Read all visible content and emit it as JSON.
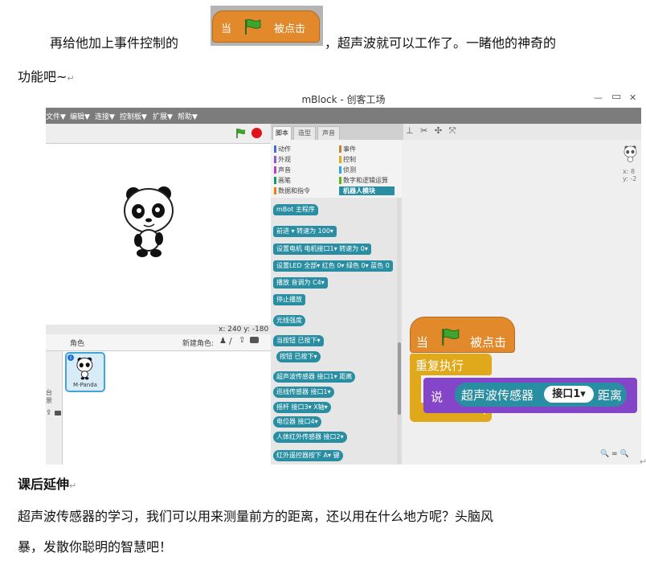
{
  "doc": {
    "line1_before": "再给他加上事件控制的",
    "line1_after": "，超声波就可以工作了。一睹他的神奇的",
    "line2": "功能吧~",
    "para_mark": "↵",
    "heading": "课后延伸",
    "body1": "超声波传感器的学习，我们可以用来测量前方的距离，还以用在什么地方呢？头脑风",
    "body2": "暴，发散你聪明的智慧吧！"
  },
  "inline_block": {
    "left_text": "当",
    "right_text": "被点击"
  },
  "app": {
    "title": "mBlock - 创客工场",
    "window_controls": [
      "—",
      "▭",
      "✕"
    ],
    "menu": [
      "文件▼",
      "编辑▼",
      "连接▼",
      "控制板▼",
      "扩展▼",
      "帮助▼"
    ],
    "tabs": [
      "脚本",
      "造型",
      "声音"
    ],
    "categories_left": [
      "动作",
      "外观",
      "声音",
      "画笔",
      "数据和指令"
    ],
    "categories_right": [
      "事件",
      "控制",
      "侦测",
      "数字和逻辑运算",
      "机器人模块"
    ],
    "category_colors_left": [
      "#4a6cd4",
      "#8a55d7",
      "#bb42c3",
      "#0e9a6c",
      "#ee7d16"
    ],
    "category_colors_right": [
      "#c88330",
      "#e1a91a",
      "#2ca5e2",
      "#5cb712",
      "#2a8ea2"
    ],
    "stage_coords": "x: 240  y: -180",
    "sprite_label": "角色",
    "new_sprite_label": "新建角色:",
    "sprite_name": "M-Panda",
    "sprite_info_x": "x: 8",
    "sprite_info_y": "y: -2",
    "left_partial": "台",
    "left_partial2": "景",
    "zoom_controls": "🔍 = 🔍",
    "palette_blocks": [
      "mBot 主程序",
      "前进 ▾ 转速为 100▾",
      "设置电机 电机接口1▾ 转速为 0▾",
      "设置LED 全部▾ 红色 0▾ 绿色 0▾ 蓝色 0",
      "播放 音调为 C4▾",
      "停止播放",
      "光线强度",
      "当按钮 已按下▾",
      "按钮 已按下▾",
      "超声波传感器 接口1▾ 距离",
      "巡线传感器 接口1▾",
      "摇杆 接口3▾ X轴▾",
      "电位器 接口4▾",
      "人体红外传感器 接口2▾",
      "红外遥控器按下 A▾ 键"
    ],
    "script": {
      "hat_left": "当",
      "hat_right": "被点击",
      "forever": "重复执行",
      "say": "说",
      "sensor": "超声波传感器",
      "port": "接口1▾",
      "distance": "距离",
      "loop_arrow": "↰"
    }
  }
}
